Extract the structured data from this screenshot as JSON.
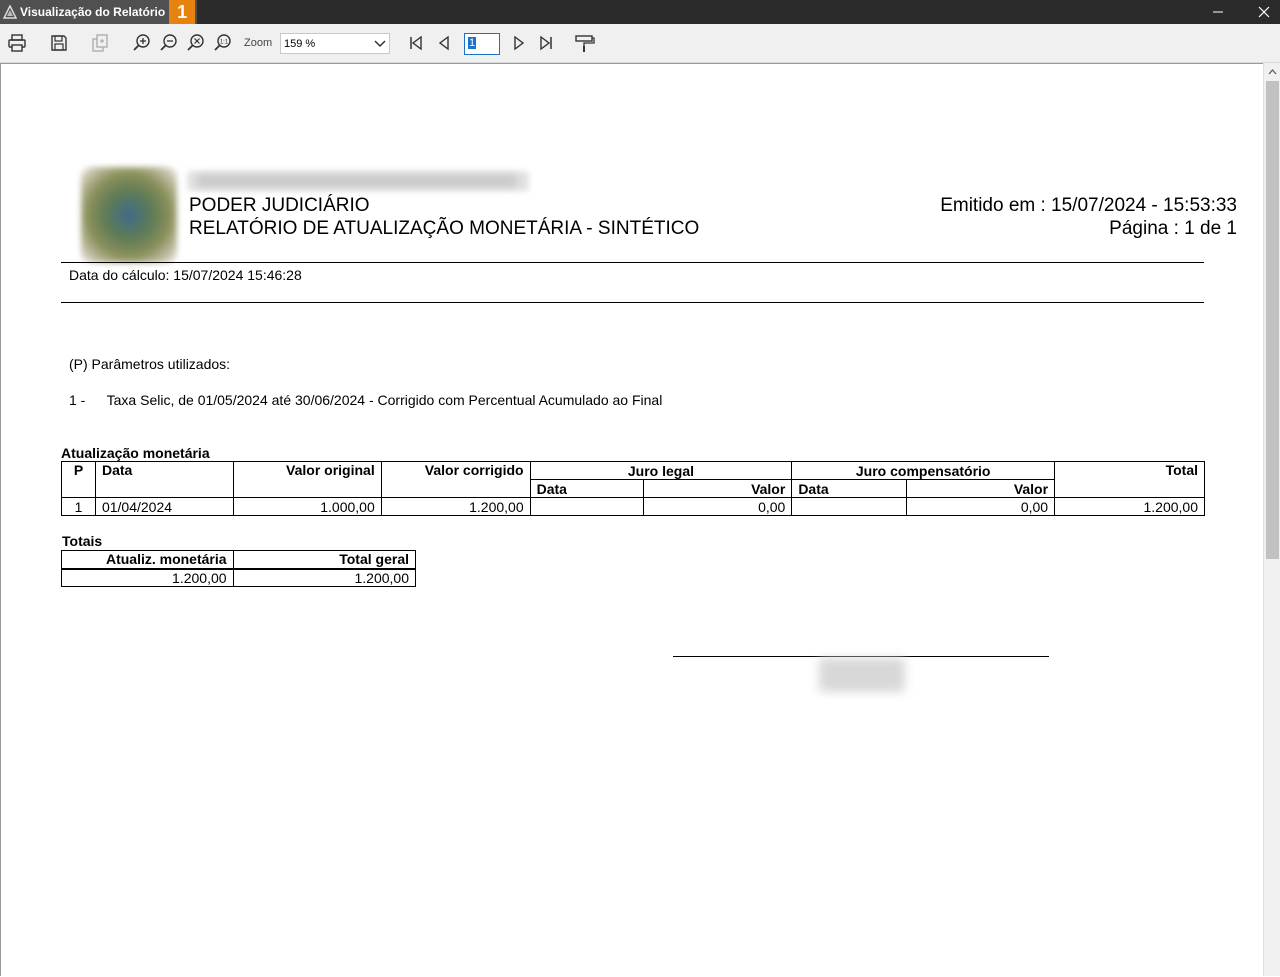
{
  "window": {
    "title": "Visualização do Relatório",
    "badge": "1"
  },
  "toolbar": {
    "zoom_label": "Zoom",
    "zoom_value": "159 %",
    "page_current": "1"
  },
  "report": {
    "org": "PODER JUDICIÁRIO",
    "title": "RELATÓRIO DE ATUALIZAÇÃO MONETÁRIA - SINTÉTICO",
    "emitido": "Emitido em : 15/07/2024 - 15:53:33",
    "pagina": "Página : 1 de 1",
    "data_calculo": "Data do cálculo: 15/07/2024 15:46:28",
    "params_title": "(P) Parâmetros utilizados:",
    "params": [
      {
        "num": "1 -",
        "text": "Taxa Selic, de 01/05/2024 até 30/06/2024 - Corrigido com Percentual Acumulado ao Final"
      }
    ],
    "atualizacao": {
      "title": "Atualização monetária",
      "headers": {
        "p": "P",
        "data": "Data",
        "valor_original": "Valor original",
        "valor_corrigido": "Valor corrigido",
        "juro_legal": "Juro legal",
        "juro_compensatorio": "Juro compensatório",
        "total": "Total",
        "sub_data": "Data",
        "sub_valor": "Valor"
      },
      "rows": [
        {
          "p": "1",
          "data": "01/04/2024",
          "valor_original": "1.000,00",
          "valor_corrigido": "1.200,00",
          "jl_data": "",
          "jl_valor": "0,00",
          "jc_data": "",
          "jc_valor": "0,00",
          "total": "1.200,00"
        }
      ]
    },
    "totais": {
      "title": "Totais",
      "headers": {
        "atualiz": "Atualiz. monetária",
        "total_geral": "Total geral"
      },
      "values": {
        "atualiz": "1.200,00",
        "total_geral": "1.200,00"
      }
    }
  }
}
